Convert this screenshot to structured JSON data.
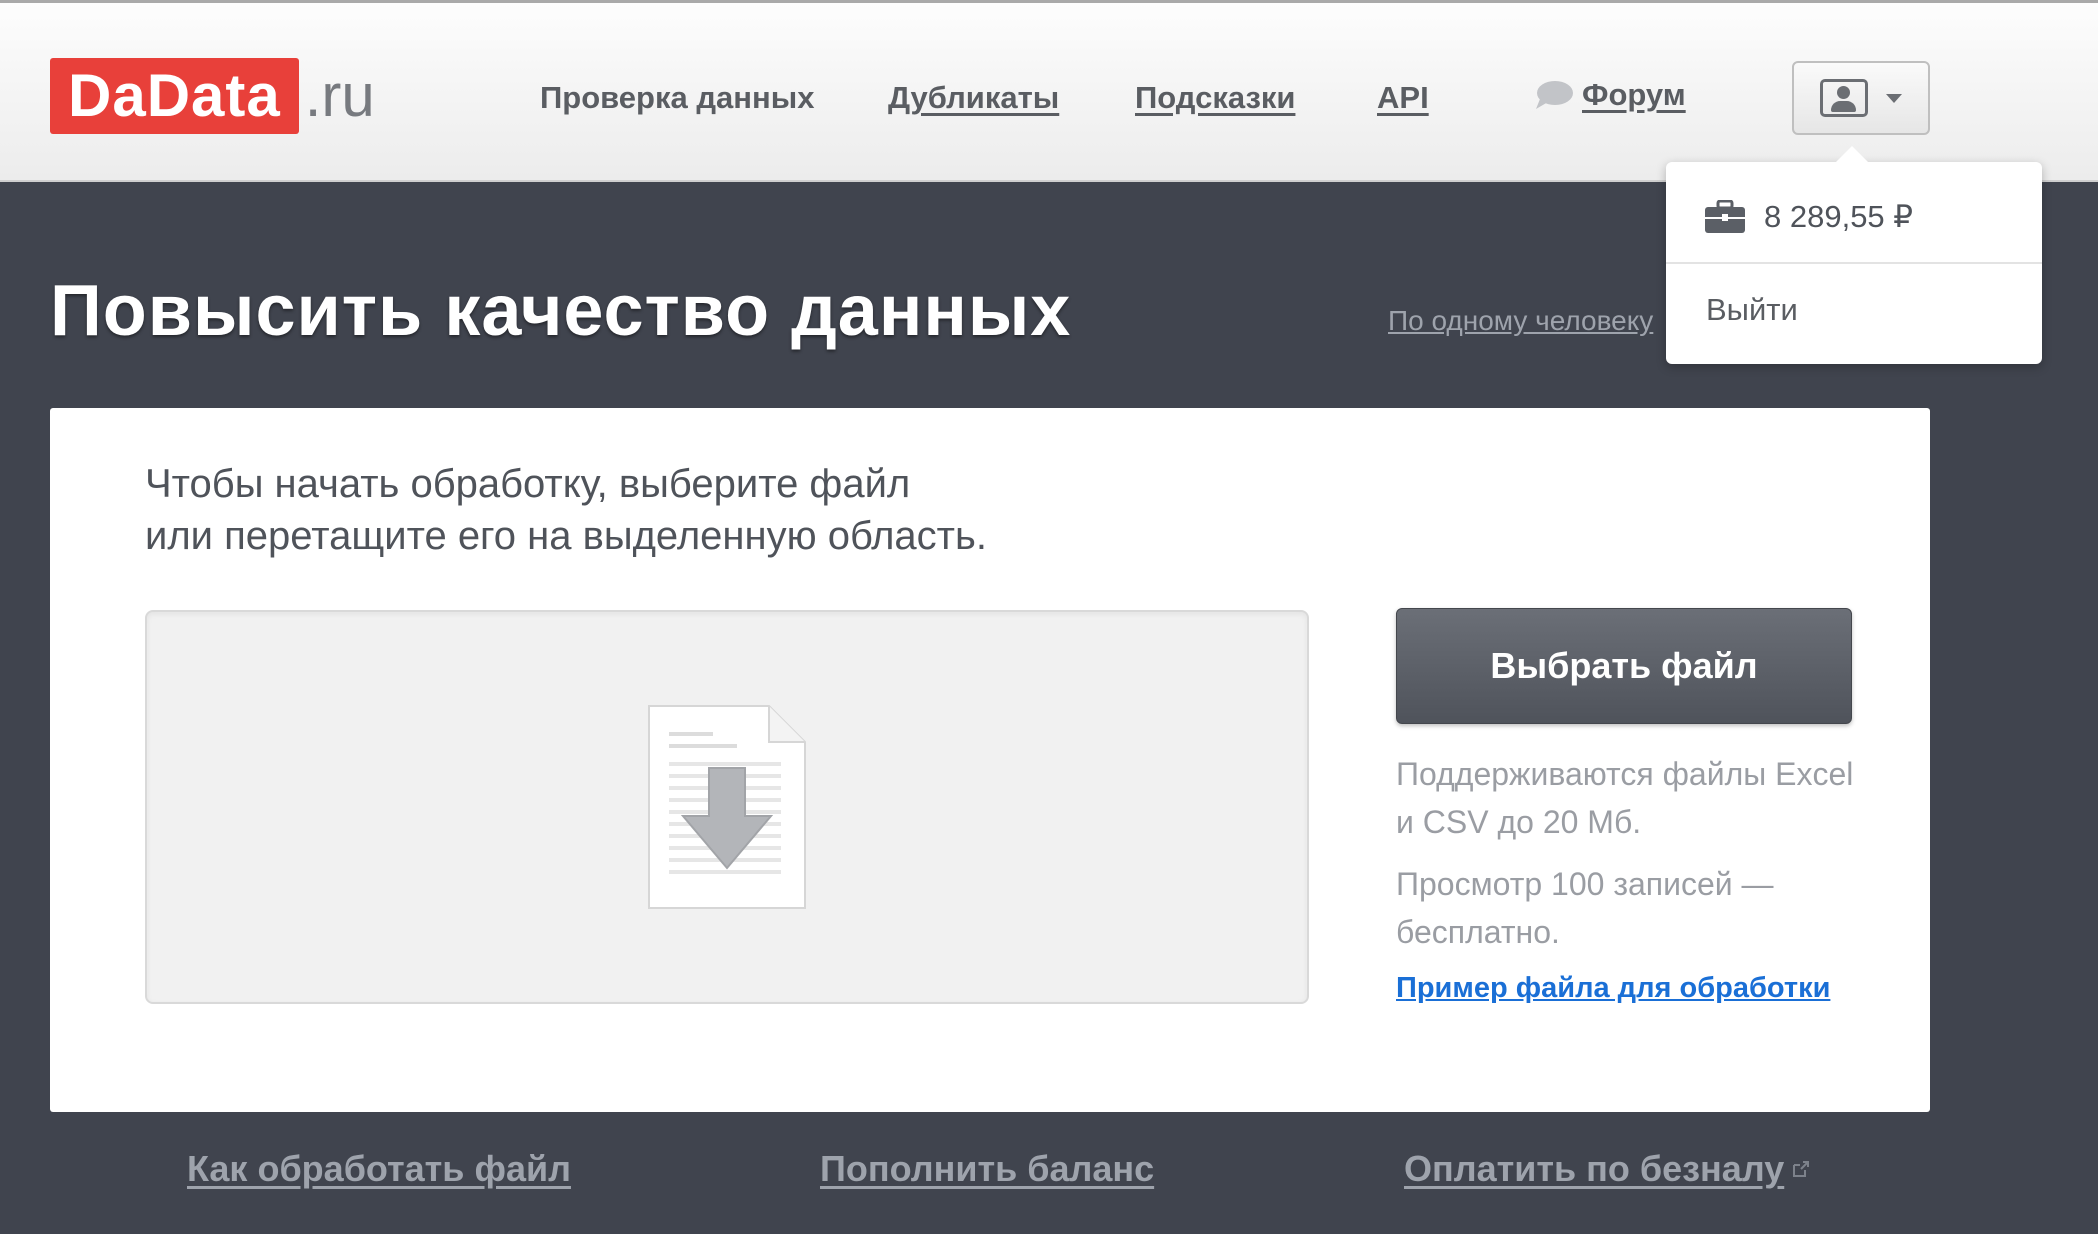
{
  "header": {
    "logo_main": "DaData",
    "logo_tld": ".ru",
    "nav": {
      "check": "Проверка данных",
      "duplicates": "Дубликаты",
      "suggestions": "Подсказки",
      "api": "API",
      "forum": "Форум"
    },
    "icons": {
      "forum": "speech-bubble-icon",
      "user": "user-card-icon",
      "menu": "chevron-down-icon"
    }
  },
  "dropdown": {
    "balance": "8 289,55 ₽",
    "logout": "Выйти",
    "icons": {
      "balance": "briefcase-icon"
    }
  },
  "main": {
    "title": "Повысить качество данных",
    "side_link": "По одному человеку",
    "card": {
      "intro_line1": "Чтобы начать обработку, выберите файл",
      "intro_line2": "или перетащите его на выделенную область.",
      "dropzone_icon": "file-download-icon",
      "choose_button": "Выбрать файл",
      "supported_line1": "Поддерживаются файлы Excel",
      "supported_line2": "и CSV до 20 Мб.",
      "preview_line1": "Просмотр 100 записей —",
      "preview_line2": "бесплатно.",
      "sample_link": "Пример файла для обработки"
    }
  },
  "footer_links": {
    "how_to": "Как обработать файл",
    "top_up": "Пополнить баланс",
    "pay_invoice": "Оплатить по безналу",
    "external_icon": "external-link-icon"
  },
  "colors": {
    "brand": "#e8403a",
    "dark_background": "#40444e",
    "link": "#1a6fd6",
    "button": "#5c6068"
  }
}
